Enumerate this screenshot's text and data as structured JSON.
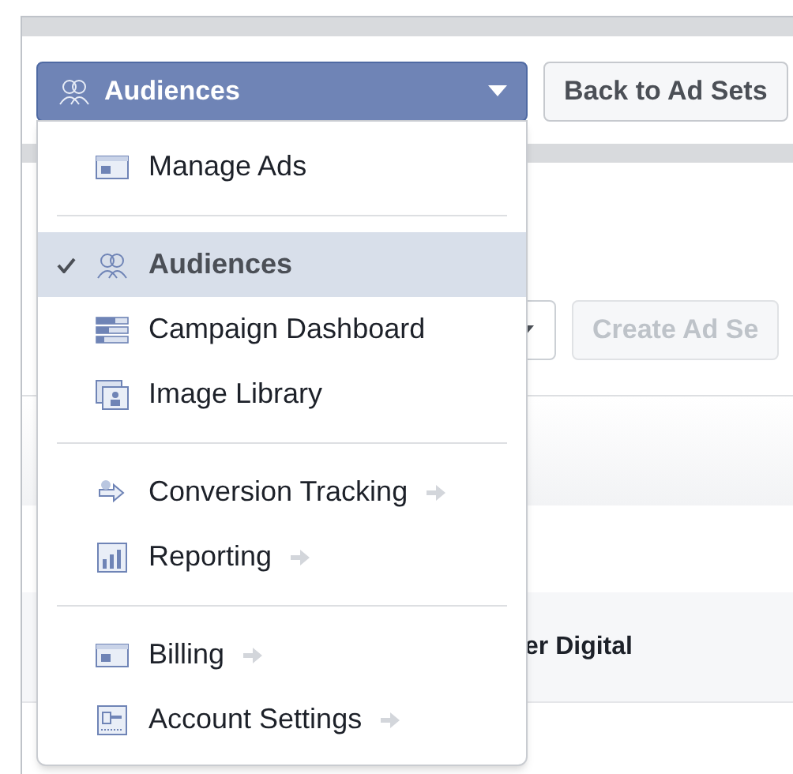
{
  "switcher": {
    "label": "Audiences"
  },
  "toolbar": {
    "back_button": "Back to Ad Sets",
    "create_button": "Create Ad Se",
    "create_disabled": true
  },
  "table": {
    "cell": "er Digital"
  },
  "menu": {
    "sections": [
      {
        "items": [
          {
            "kind": "ads",
            "label": "Manage Ads",
            "selected": false,
            "arrow": false
          }
        ]
      },
      {
        "items": [
          {
            "kind": "audiences",
            "label": "Audiences",
            "selected": true,
            "arrow": false
          },
          {
            "kind": "dashboard",
            "label": "Campaign Dashboard",
            "selected": false,
            "arrow": false
          },
          {
            "kind": "images",
            "label": "Image Library",
            "selected": false,
            "arrow": false
          }
        ]
      },
      {
        "items": [
          {
            "kind": "conversion",
            "label": "Conversion Tracking",
            "selected": false,
            "arrow": true
          },
          {
            "kind": "reporting",
            "label": "Reporting",
            "selected": false,
            "arrow": true
          }
        ]
      },
      {
        "items": [
          {
            "kind": "billing",
            "label": "Billing",
            "selected": false,
            "arrow": true
          },
          {
            "kind": "account",
            "label": "Account Settings",
            "selected": false,
            "arrow": true
          }
        ]
      }
    ]
  }
}
